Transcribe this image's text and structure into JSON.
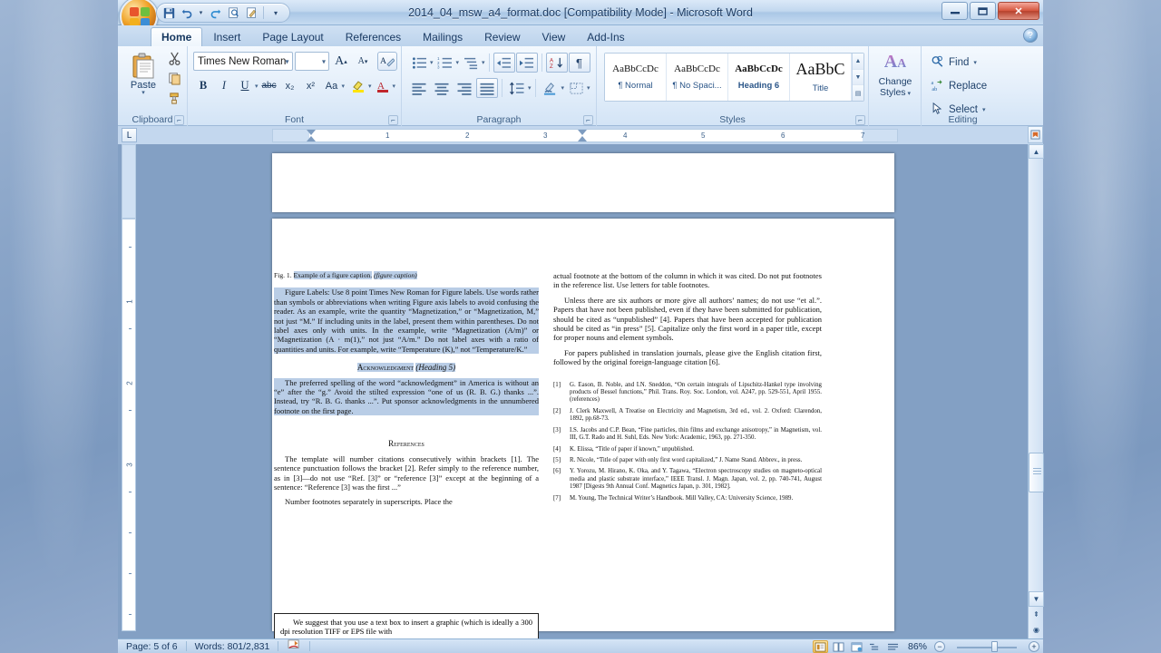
{
  "window": {
    "title": "2014_04_msw_a4_format.doc [Compatibility Mode] - Microsoft Word",
    "minimize": "—",
    "restore": "❐",
    "close": "✕",
    "help": "?"
  },
  "quick_access": {
    "save": "save-icon",
    "undo": "undo-icon",
    "redo": "redo-icon",
    "print_preview": "print-preview-icon",
    "edit": "edit-icon",
    "customize": "▾"
  },
  "tabs": [
    {
      "label": "Home",
      "active": true
    },
    {
      "label": "Insert",
      "active": false
    },
    {
      "label": "Page Layout",
      "active": false
    },
    {
      "label": "References",
      "active": false
    },
    {
      "label": "Mailings",
      "active": false
    },
    {
      "label": "Review",
      "active": false
    },
    {
      "label": "View",
      "active": false
    },
    {
      "label": "Add-Ins",
      "active": false
    }
  ],
  "ribbon": {
    "clipboard": {
      "label": "Clipboard",
      "paste": "Paste",
      "cut": "✂",
      "copy": "⧉",
      "format_painter": "🖌"
    },
    "font": {
      "label": "Font",
      "font_name": "Times New Roman",
      "font_size": "",
      "grow_font": "A",
      "shrink_font": "A",
      "clear_formatting": "A",
      "bold": "B",
      "italic": "I",
      "underline": "U",
      "strikethrough": "abc",
      "subscript": "x₂",
      "superscript": "x²",
      "change_case": "Aa",
      "highlight": "ab",
      "font_color": "A"
    },
    "paragraph": {
      "label": "Paragraph",
      "bullets": "☰",
      "numbering": "☰",
      "multilevel": "☰",
      "decrease_indent": "⇤",
      "increase_indent": "⇥",
      "sort": "A↓",
      "show_marks": "¶",
      "align_left": "☰",
      "align_center": "☰",
      "align_right": "☰",
      "justify": "☰",
      "line_spacing": "↕",
      "shading": "▨",
      "borders": "⊞"
    },
    "styles": {
      "label": "Styles",
      "items": [
        {
          "sample": "AaBbCcDc",
          "name": "¶ Normal",
          "size": "11px",
          "weight": "normal"
        },
        {
          "sample": "AaBbCcDc",
          "name": "¶ No Spaci...",
          "size": "11px",
          "weight": "normal"
        },
        {
          "sample": "AaBbCcDc",
          "name": "Heading 6",
          "size": "11px",
          "weight": "bold"
        },
        {
          "sample": "AaBbC",
          "name": "Title",
          "size": "18px",
          "weight": "normal"
        }
      ],
      "scroll_up": "▲",
      "scroll_down": "▼",
      "more": "▤"
    },
    "change_styles": {
      "label": "Change\nStyles",
      "line1": "Change",
      "line2": "Styles",
      "glyph": "A"
    },
    "editing": {
      "label": "Editing",
      "find": "Find",
      "replace": "Replace",
      "select": "Select"
    }
  },
  "ruler": {
    "tab_stop": "L",
    "h_numbers": [
      "1",
      "1",
      "2",
      "3",
      "4",
      "5",
      "6",
      "7"
    ],
    "v_numbers": [
      "1",
      "2",
      "3"
    ]
  },
  "document": {
    "figure_caption_prefix": "Fig. 1.",
    "figure_caption_text": "Example of a figure caption.",
    "figure_caption_italic": "(figure caption)",
    "left_column": {
      "figure_labels_para": "Figure Labels: Use 8 point Times New Roman for Figure labels. Use words rather than symbols or abbreviations when writing Figure axis labels to avoid confusing the reader. As an example, write the quantity “Magnetization,” or “Magnetization, M,” not just “M.” If including units in the label, present them within parentheses. Do not label axes only with units. In the example, write “Magnetization (A/m)” or “Magnetization (A · m(1),” not just “A/m.” Do not label axes with a ratio of quantities and units. For example, write “Temperature (K),” not “Temperature/K.”",
      "acknowledgment_heading": "Acknowledgment",
      "acknowledgment_heading_italic": "(Heading 5)",
      "acknowledgment_para": "The preferred spelling of the word “acknowledgment” in America is without an “e” after the “g.” Avoid the stilted expression “one of us (R. B. G.) thanks ...”. Instead, try “R. B. G. thanks ...”. Put sponsor acknowledgments in the unnumbered footnote on the first page.",
      "references_heading": "References",
      "references_para1": "The template will number citations consecutively within brackets [1]. The sentence punctuation follows the bracket [2]. Refer simply to the reference number, as in [3]—do not use “Ref. [3]” or “reference [3]” except at the beginning of a sentence: “Reference [3] was the first ...”",
      "references_para2": "Number footnotes separately in superscripts. Place the",
      "textbox_text": "We suggest that you use a text box to insert a graphic (which is ideally a 300 dpi resolution TIFF or EPS file with"
    },
    "right_column": {
      "para1": "actual footnote at the bottom of the column in which it was cited. Do not put footnotes in the reference list. Use letters for table footnotes.",
      "para2": "Unless there are six authors or more give all authors’ names; do not use “et al.”. Papers that have not been published, even if they have been submitted for publication, should be cited as “unpublished” [4]. Papers that have been accepted for publication should be cited as “in press” [5]. Capitalize only the first word in a paper title, except for proper nouns and element symbols.",
      "para3": "For papers published in translation journals, please give the English citation first, followed by the original foreign-language citation [6].",
      "references": [
        {
          "num": "[1]",
          "text": "G. Eason, B. Noble, and I.N. Sneddon, “On certain integrals of Lipschitz-Hankel type involving products of Bessel functions,” Phil. Trans. Roy. Soc. London, vol. A247, pp. 529-551, April 1955. (references)"
        },
        {
          "num": "[2]",
          "text": "J. Clerk Maxwell, A Treatise on Electricity and Magnetism, 3rd ed., vol. 2. Oxford: Clarendon, 1892, pp.68-73."
        },
        {
          "num": "[3]",
          "text": "I.S. Jacobs and C.P. Bean, “Fine particles, thin films and exchange anisotropy,” in Magnetism, vol. III, G.T. Rado and H. Suhl, Eds. New York: Academic, 1963, pp. 271-350."
        },
        {
          "num": "[4]",
          "text": "K. Elissa, “Title of paper if known,” unpublished."
        },
        {
          "num": "[5]",
          "text": "R. Nicole, “Title of paper with only first word capitalized,” J. Name Stand. Abbrev., in press."
        },
        {
          "num": "[6]",
          "text": "Y. Yorozu, M. Hirano, K. Oka, and Y. Tagawa, “Electron spectroscopy studies on magneto-optical media and plastic substrate interface,” IEEE Transl. J. Magn. Japan, vol. 2, pp. 740-741, August 1987 [Digests 9th Annual Conf. Magnetics Japan, p. 301, 1982]."
        },
        {
          "num": "[7]",
          "text": "M. Young, The Technical Writer’s Handbook. Mill Valley, CA: University Science, 1989."
        }
      ]
    }
  },
  "status_bar": {
    "page": "Page: 5 of 6",
    "words": "Words: 801/2,831",
    "proofing": "proofing-errors-icon",
    "views": [
      "print-layout",
      "full-screen-reading",
      "web-layout",
      "outline",
      "draft"
    ],
    "zoom": "86%",
    "zoom_out": "−",
    "zoom_in": "+"
  }
}
